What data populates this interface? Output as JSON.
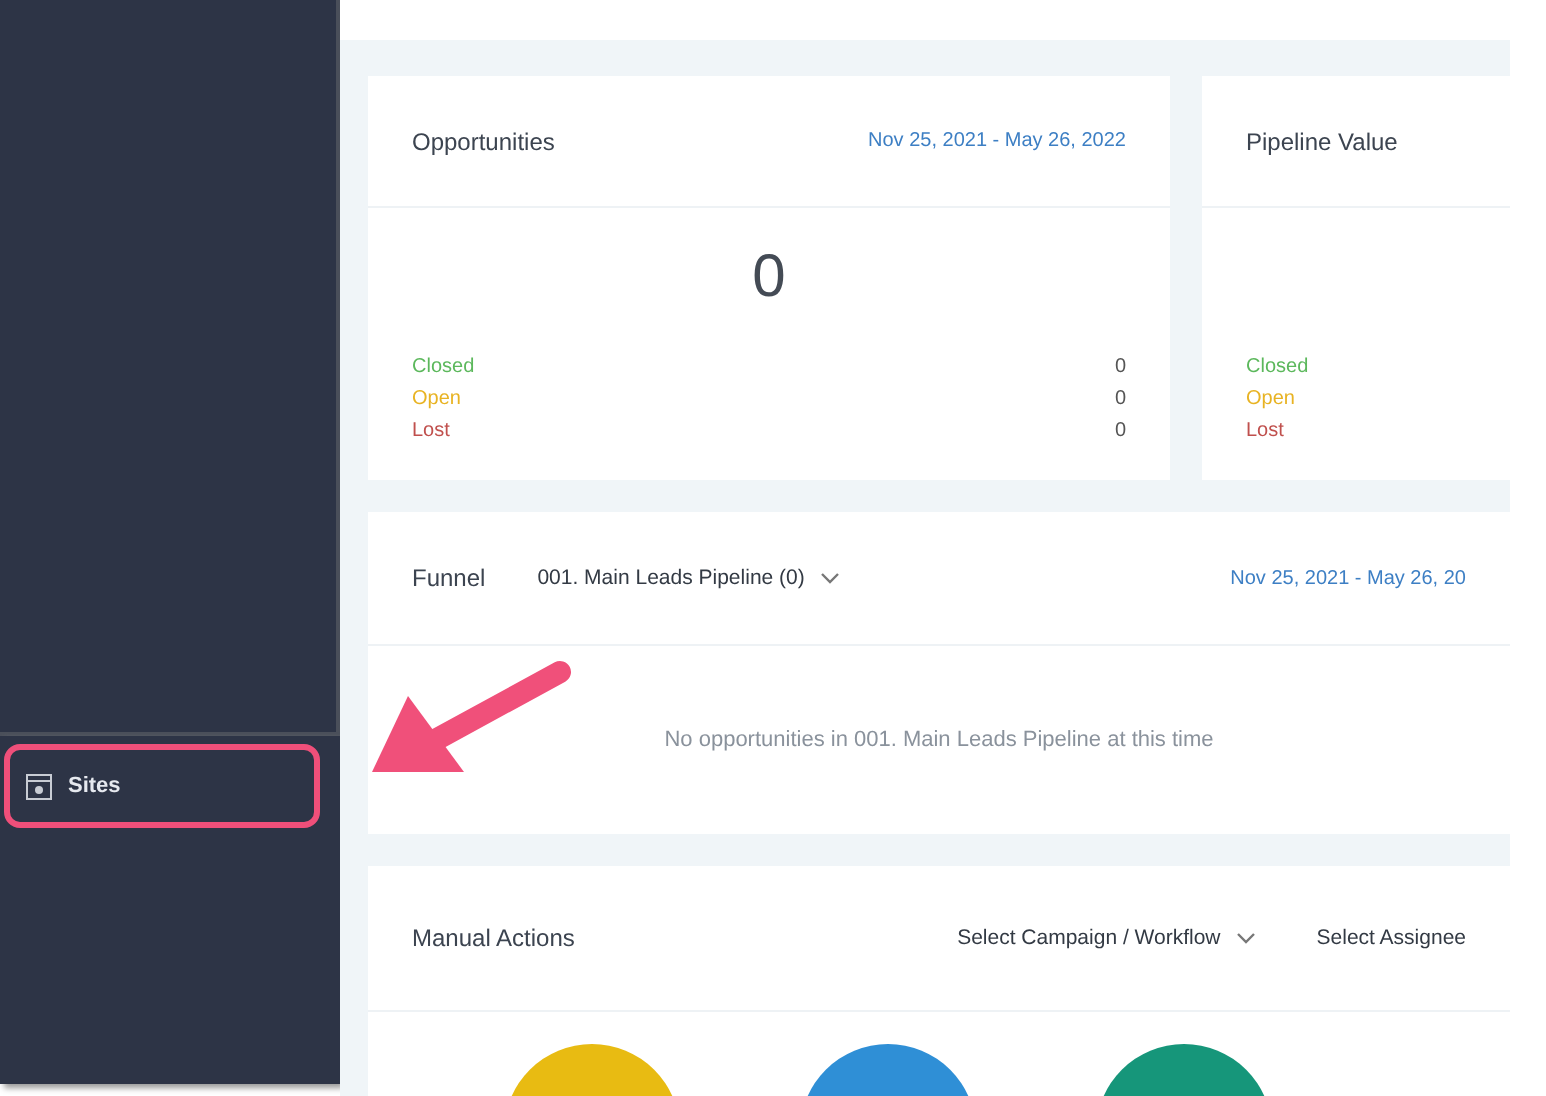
{
  "sidebar": {
    "items": [
      {
        "label": "Sites",
        "selected": true
      }
    ]
  },
  "stat_cards": [
    {
      "title": "Opportunities",
      "date_range": "Nov 25, 2021 - May 26, 2022",
      "total": "0",
      "rows": [
        {
          "label": "Closed",
          "value": "0",
          "color": "#5cb85c"
        },
        {
          "label": "Open",
          "value": "0",
          "color": "#e8b323"
        },
        {
          "label": "Lost",
          "value": "0",
          "color": "#c0504d"
        }
      ]
    },
    {
      "title": "Pipeline Value",
      "rows": [
        {
          "label": "Closed",
          "color": "#5cb85c"
        },
        {
          "label": "Open",
          "color": "#e8b323"
        },
        {
          "label": "Lost",
          "color": "#c0504d"
        }
      ]
    }
  ],
  "funnel": {
    "title": "Funnel",
    "pipeline": "001. Main Leads Pipeline (0)",
    "date_range": "Nov 25, 2021 - May 26, 20",
    "empty_message": "No opportunities in 001. Main Leads Pipeline at this time"
  },
  "manual_actions": {
    "title": "Manual Actions",
    "campaign_select": "Select Campaign / Workflow",
    "assignee_select": "Select Assignee",
    "circles": [
      {
        "color": "#e8bb12"
      },
      {
        "color": "#2f8fd6"
      },
      {
        "color": "#16967a"
      }
    ]
  }
}
